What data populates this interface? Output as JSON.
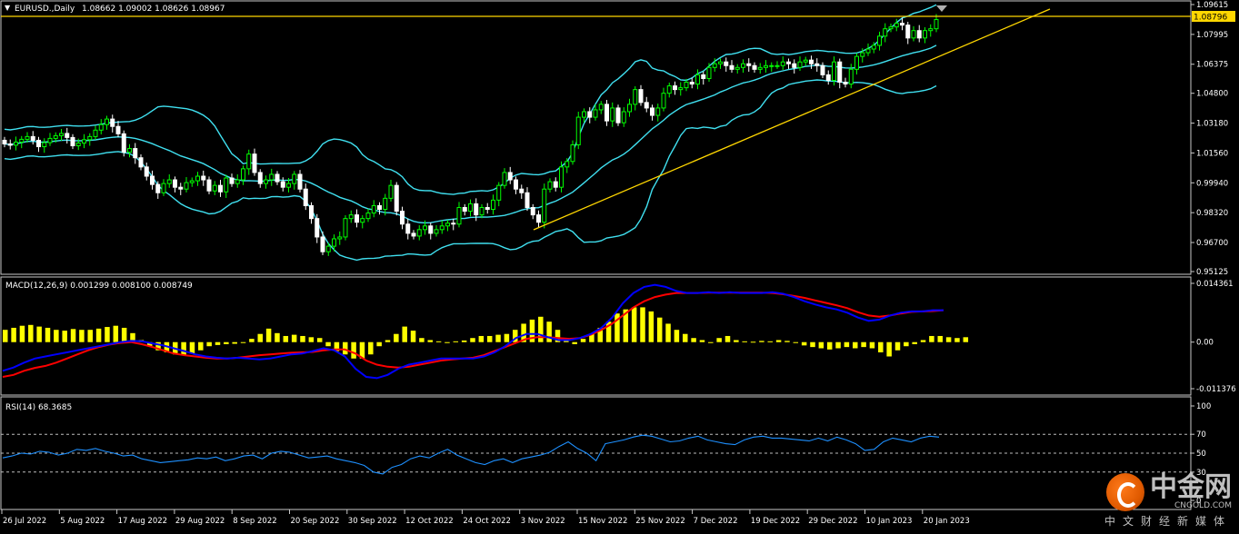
{
  "header": {
    "menu_glyph": "▼",
    "title": "EURUSD.,Daily",
    "ohlc": "1.08662 1.09002 1.08626 1.08967"
  },
  "price_axis": {
    "ticks": [
      "1.09615",
      "1.07995",
      "1.06375",
      "1.04800",
      "1.03180",
      "1.01560",
      "0.99940",
      "0.98320",
      "0.96700",
      "0.95125"
    ],
    "current_price_label": "1.08796"
  },
  "macd": {
    "label": "MACD(12,26,9) 0.001299 0.008100 0.008749",
    "ticks": [
      "0.014361",
      "0.00",
      "-0.011376"
    ]
  },
  "rsi": {
    "label": "RSI(14) 68.3685",
    "ticks": [
      "100",
      "70",
      "50",
      "30",
      "0"
    ]
  },
  "date_axis": [
    "26 Jul 2022",
    "5 Aug 2022",
    "17 Aug 2022",
    "29 Aug 2022",
    "8 Sep 2022",
    "20 Sep 2022",
    "30 Sep 2022",
    "12 Oct 2022",
    "24 Oct 2022",
    "3 Nov 2022",
    "15 Nov 2022",
    "25 Nov 2022",
    "7 Dec 2022",
    "19 Dec 2022",
    "29 Dec 2022",
    "10 Jan 2023",
    "20 Jan 2023"
  ],
  "watermark": {
    "name": "中金网",
    "domain": "CNGOLD.COM",
    "tagline": "中文财经新媒体"
  },
  "colors": {
    "background": "#000000",
    "bull": "#00ff00",
    "bear": "#ffffff",
    "bollinger": "#40e0f0",
    "trendline": "#ffd700",
    "macd_hist": "#ffff00",
    "macd_main": "#0000ff",
    "macd_signal": "#ff0000",
    "rsi_line": "#1e90ff"
  },
  "chart_data": [
    {
      "type": "candlestick",
      "title": "EURUSD.,Daily",
      "ylim": [
        0.95125,
        1.09615
      ],
      "close": [
        1.0205,
        1.0198,
        1.0215,
        1.023,
        1.0245,
        1.0225,
        1.019,
        1.0212,
        1.0235,
        1.025,
        1.0262,
        1.024,
        1.0195,
        1.021,
        1.0228,
        1.0245,
        1.028,
        1.031,
        1.034,
        1.03,
        1.026,
        1.016,
        1.018,
        1.013,
        1.008,
        1.003,
        0.9985,
        0.994,
        0.999,
        1.001,
        0.997,
        0.996,
        0.9995,
        1.0005,
        1.003,
        1.001,
        0.995,
        0.998,
        0.9945,
        1.002,
        0.999,
        1.001,
        1.007,
        1.015,
        1.005,
        0.999,
        1.001,
        1.004,
        1.0,
        0.997,
        0.999,
        1.004,
        0.996,
        0.987,
        0.98,
        0.97,
        0.962,
        0.965,
        0.969,
        0.97,
        0.98,
        0.982,
        0.978,
        0.98,
        0.983,
        0.987,
        0.985,
        0.991,
        0.998,
        0.984,
        0.977,
        0.972,
        0.9705,
        0.974,
        0.976,
        0.972,
        0.974,
        0.976,
        0.9775,
        0.977,
        0.986,
        0.984,
        0.988,
        0.982,
        0.986,
        0.985,
        0.99,
        0.998,
        1.005,
        1.001,
        0.996,
        0.994,
        0.986,
        0.982,
        0.978,
        0.996,
        1.0,
        0.997,
        1.008,
        1.011,
        1.02,
        1.035,
        1.038,
        1.035,
        1.039,
        1.042,
        1.033,
        1.04,
        1.032,
        1.038,
        1.042,
        1.05,
        1.043,
        1.04,
        1.036,
        1.04,
        1.048,
        1.052,
        1.05,
        1.051,
        1.054,
        1.053,
        1.058,
        1.056,
        1.062,
        1.064,
        1.065,
        1.063,
        1.061,
        1.062,
        1.064,
        1.063,
        1.061,
        1.062,
        1.063,
        1.063,
        1.063,
        1.065,
        1.064,
        1.062,
        1.065,
        1.066,
        1.064,
        1.063,
        1.058,
        1.055,
        1.065,
        1.054,
        1.053,
        1.061,
        1.068,
        1.07,
        1.072,
        1.074,
        1.079,
        1.083,
        1.084,
        1.086,
        1.085,
        1.078,
        1.082,
        1.078,
        1.082,
        1.083,
        1.088
      ]
    },
    {
      "type": "bar",
      "title": "MACD(12,26,9) 0.001299 0.008100 0.008749",
      "ylim": [
        -0.011376,
        0.014361
      ],
      "histogram": [
        0.003,
        0.0035,
        0.004,
        0.0042,
        0.0038,
        0.0035,
        0.003,
        0.0028,
        0.0032,
        0.003,
        0.003,
        0.0033,
        0.0037,
        0.004,
        0.0035,
        0.0022,
        0.0005,
        -0.001,
        -0.002,
        -0.0025,
        -0.003,
        -0.0032,
        -0.0028,
        -0.002,
        -0.001,
        -0.0007,
        -0.0005,
        -0.0004,
        0.0,
        0.0008,
        0.002,
        0.0033,
        0.0022,
        0.0015,
        0.0018,
        0.0015,
        0.0012,
        0.001,
        -0.001,
        -0.0022,
        -0.003,
        -0.004,
        -0.004,
        -0.003,
        -0.001,
        0.0005,
        0.002,
        0.0038,
        0.0028,
        0.001,
        0.0005,
        0.0002,
        -0.0001,
        0.0002,
        0.0004,
        0.001,
        0.0015,
        0.0015,
        0.0018,
        0.002,
        0.003,
        0.0045,
        0.0055,
        0.0062,
        0.005,
        0.003,
        0.001,
        -0.0005,
        0.0008,
        0.002,
        0.0035,
        0.005,
        0.007,
        0.008,
        0.0085,
        0.0085,
        0.0075,
        0.006,
        0.0045,
        0.003,
        0.002,
        0.001,
        0.0005,
        -0.0002,
        0.001,
        0.0015,
        0.0005,
        0.0002,
        0.0001,
        0.0003,
        0.0002,
        0.0005,
        0.0003,
        -0.0002,
        -0.0008,
        -0.0012,
        -0.0015,
        -0.0018,
        -0.0015,
        -0.0012,
        -0.0015,
        -0.0012,
        -0.0015,
        -0.0025,
        -0.0035,
        -0.002,
        -0.001,
        -0.0005,
        0.0005,
        0.0015,
        0.0015,
        0.0012,
        0.001,
        0.0012
      ],
      "macd": [
        -0.007,
        -0.0062,
        -0.005,
        -0.004,
        -0.0035,
        -0.003,
        -0.0025,
        -0.002,
        -0.0015,
        -0.001,
        -0.0005,
        0.0,
        0.0003,
        0.0002,
        -0.0003,
        -0.0008,
        -0.0015,
        -0.0022,
        -0.003,
        -0.0035,
        -0.0038,
        -0.004,
        -0.0038,
        -0.004,
        -0.0042,
        -0.004,
        -0.0035,
        -0.003,
        -0.0028,
        -0.0022,
        -0.0015,
        -0.002,
        -0.0035,
        -0.0065,
        -0.0085,
        -0.0088,
        -0.008,
        -0.0065,
        -0.0055,
        -0.005,
        -0.0045,
        -0.004,
        -0.004,
        -0.004,
        -0.004,
        -0.0035,
        -0.0025,
        -0.001,
        0.001,
        0.002,
        0.002,
        0.0012,
        0.0005,
        0.0005,
        0.001,
        0.002,
        0.0035,
        0.006,
        0.0095,
        0.012,
        0.0135,
        0.014,
        0.0135,
        0.0125,
        0.012,
        0.012,
        0.0122,
        0.012,
        0.0122,
        0.012,
        0.012,
        0.012,
        0.0122,
        0.0118,
        0.011,
        0.01,
        0.0092,
        0.0085,
        0.008,
        0.0072,
        0.006,
        0.0052,
        0.0055,
        0.0065,
        0.0072,
        0.0075,
        0.0075,
        0.0078,
        0.0078
      ],
      "signal": [
        -0.0085,
        -0.008,
        -0.007,
        -0.0063,
        -0.0058,
        -0.005,
        -0.004,
        -0.003,
        -0.002,
        -0.0012,
        -0.0006,
        -0.0002,
        0.0,
        -0.0005,
        -0.0012,
        -0.002,
        -0.0028,
        -0.0032,
        -0.0035,
        -0.0038,
        -0.004,
        -0.004,
        -0.0038,
        -0.0035,
        -0.0032,
        -0.003,
        -0.0028,
        -0.0026,
        -0.0025,
        -0.0024,
        -0.002,
        -0.0018,
        -0.0018,
        -0.0028,
        -0.0045,
        -0.0055,
        -0.006,
        -0.0062,
        -0.006,
        -0.0055,
        -0.005,
        -0.0045,
        -0.0042,
        -0.004,
        -0.0038,
        -0.0032,
        -0.0022,
        -0.0012,
        -0.0002,
        0.0008,
        0.0012,
        0.0012,
        0.001,
        0.0008,
        0.001,
        0.0018,
        0.003,
        0.0045,
        0.0065,
        0.0085,
        0.01,
        0.011,
        0.0116,
        0.012,
        0.012,
        0.012,
        0.0121,
        0.0121,
        0.0121,
        0.0121,
        0.0121,
        0.0121,
        0.012,
        0.0117,
        0.0113,
        0.0108,
        0.0102,
        0.0096,
        0.009,
        0.0083,
        0.0073,
        0.0065,
        0.0062,
        0.0065,
        0.007,
        0.0074,
        0.0075,
        0.0076,
        0.0078
      ]
    },
    {
      "type": "line",
      "title": "RSI(14) 68.3685",
      "ylim": [
        0,
        100
      ],
      "levels": [
        70,
        50,
        30
      ],
      "values": [
        45,
        47,
        50,
        49,
        52,
        51,
        48,
        50,
        54,
        53,
        55,
        52,
        50,
        47,
        48,
        44,
        42,
        40,
        41,
        42,
        43,
        45,
        44,
        46,
        42,
        44,
        47,
        48,
        44,
        50,
        52,
        51,
        48,
        45,
        46,
        47,
        44,
        42,
        40,
        37,
        30,
        28,
        35,
        38,
        44,
        47,
        45,
        50,
        54,
        48,
        44,
        40,
        38,
        42,
        44,
        40,
        44,
        46,
        48,
        51,
        57,
        62,
        55,
        50,
        42,
        60,
        62,
        64,
        67,
        69,
        68,
        65,
        62,
        63,
        66,
        68,
        64,
        62,
        60,
        59,
        64,
        67,
        68,
        66,
        66,
        65,
        64,
        63,
        66,
        63,
        67,
        64,
        60,
        53,
        54,
        62,
        66,
        64,
        62,
        66,
        68,
        67
      ]
    }
  ]
}
